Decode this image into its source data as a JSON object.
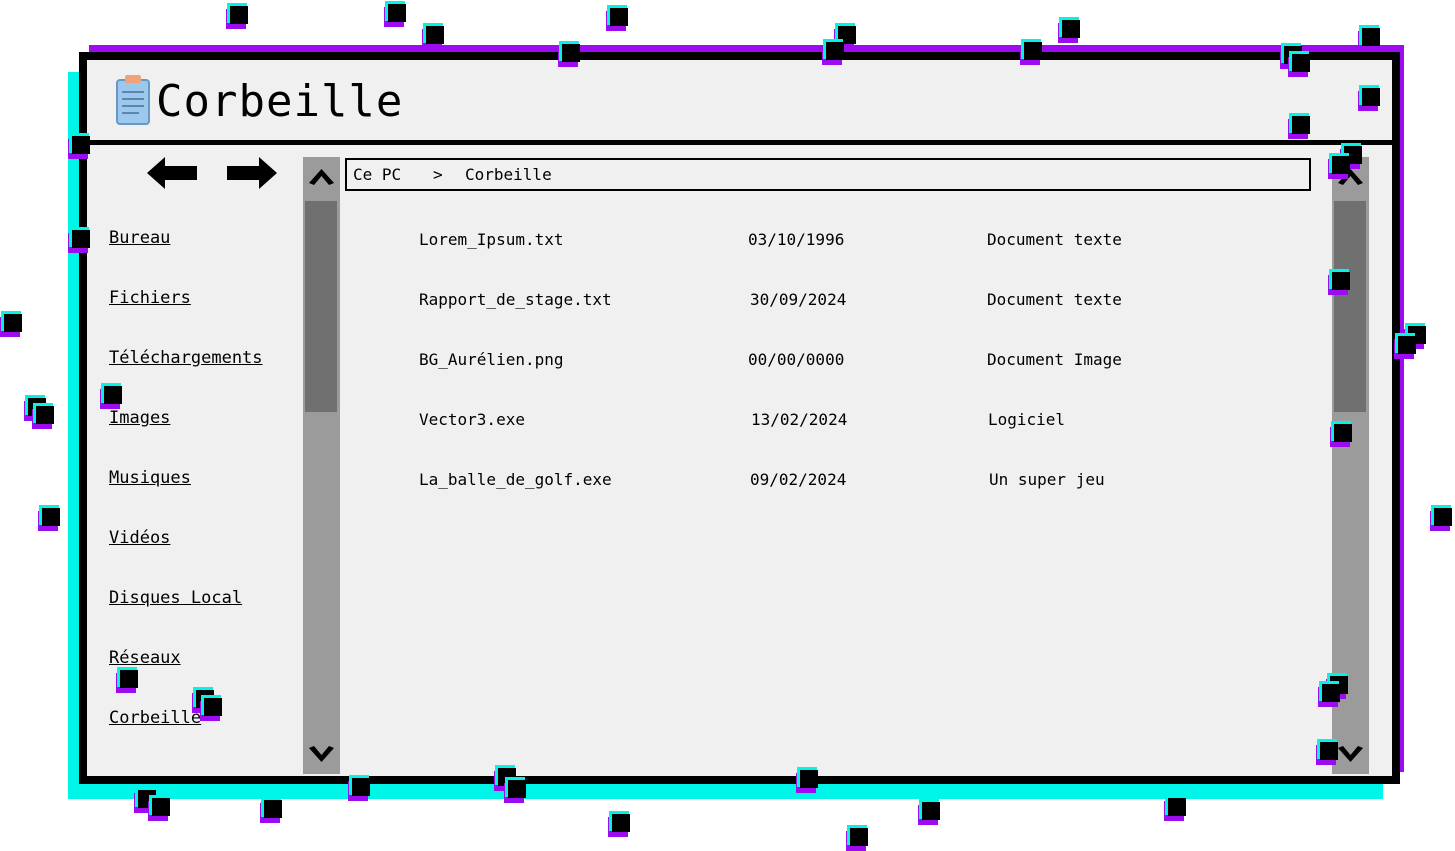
{
  "window": {
    "title": "Corbeille",
    "icon": "notepad-icon"
  },
  "nav": {
    "back_icon": "arrow-left-icon",
    "forward_icon": "arrow-right-icon"
  },
  "sidebar": {
    "items": [
      {
        "label": "Bureau"
      },
      {
        "label": "Fichiers"
      },
      {
        "label": "Téléchargements"
      },
      {
        "label": "Images"
      },
      {
        "label": "Musiques"
      },
      {
        "label": "Vidéos"
      },
      {
        "label": "Disques Local"
      },
      {
        "label": "Réseaux"
      },
      {
        "label": "Corbeille"
      }
    ]
  },
  "breadcrumb": {
    "root": "Ce PC",
    "separator": ">",
    "current": "Corbeille"
  },
  "files": [
    {
      "name": "Lorem_Ipsum.txt",
      "date": "03/10/1996",
      "type": "Document texte"
    },
    {
      "name": "Rapport_de_stage.txt",
      "date": "30/09/2024",
      "type": "Document texte"
    },
    {
      "name": "BG_Aurélien.png",
      "date": "00/00/0000",
      "type": "Document Image"
    },
    {
      "name": "Vector3.exe",
      "date": "13/02/2024",
      "type": "Logiciel"
    },
    {
      "name": "La_balle_de_golf.exe",
      "date": "09/02/2024",
      "type": "Un super jeu"
    }
  ],
  "colors": {
    "window_bg": "#f0f0f0",
    "border": "#000000",
    "accent_cyan": "#00f5e9",
    "accent_purple": "#9d0cf0",
    "scrollbar_track": "#9b9b9b",
    "scrollbar_thumb": "#707070"
  }
}
